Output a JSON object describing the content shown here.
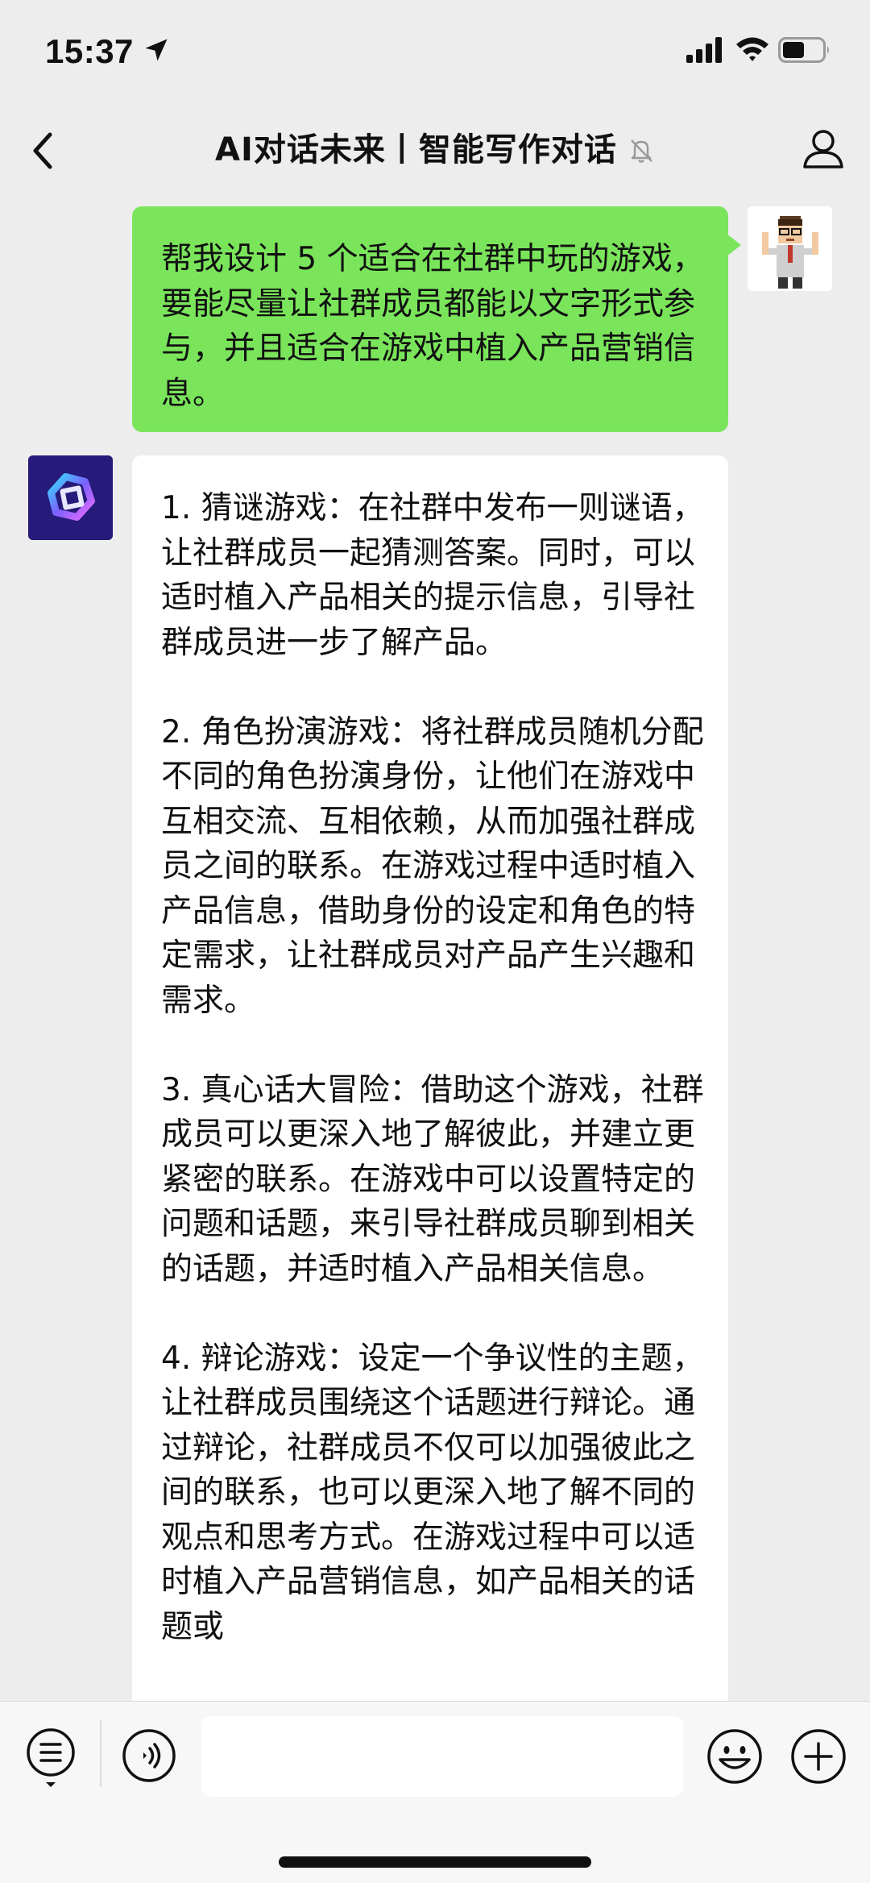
{
  "status_bar": {
    "time": "15:37"
  },
  "nav": {
    "title": "AI对话未来丨智能写作对话"
  },
  "messages": {
    "user": "帮我设计 5 个适合在社群中玩的游戏，要能尽量让社群成员都能以文字形式参与，并且适合在游戏中植入产品营销信息。",
    "ai_paragraphs": [
      "1. 猜谜游戏：在社群中发布一则谜语，让社群成员一起猜测答案。同时，可以适时植入产品相关的提示信息，引导社群成员进一步了解产品。",
      "2. 角色扮演游戏：将社群成员随机分配不同的角色扮演身份，让他们在游戏中互相交流、互相依赖，从而加强社群成员之间的联系。在游戏过程中适时植入产品信息，借助身份的设定和角色的特定需求，让社群成员对产品产生兴趣和需求。",
      "3. 真心话大冒险：借助这个游戏，社群成员可以更深入地了解彼此，并建立更紧密的联系。在游戏中可以设置特定的问题和话题，来引导社群成员聊到相关的话题，并适时植入产品相关信息。",
      "4. 辩论游戏：设定一个争议性的主题，让社群成员围绕这个话题进行辩论。通过辩论，社群成员不仅可以加强彼此之间的联系，也可以更深入地了解不同的观点和思考方式。在游戏过程中可以适时植入产品营销信息，如产品相关的话题或"
    ]
  },
  "input": {
    "value": ""
  }
}
